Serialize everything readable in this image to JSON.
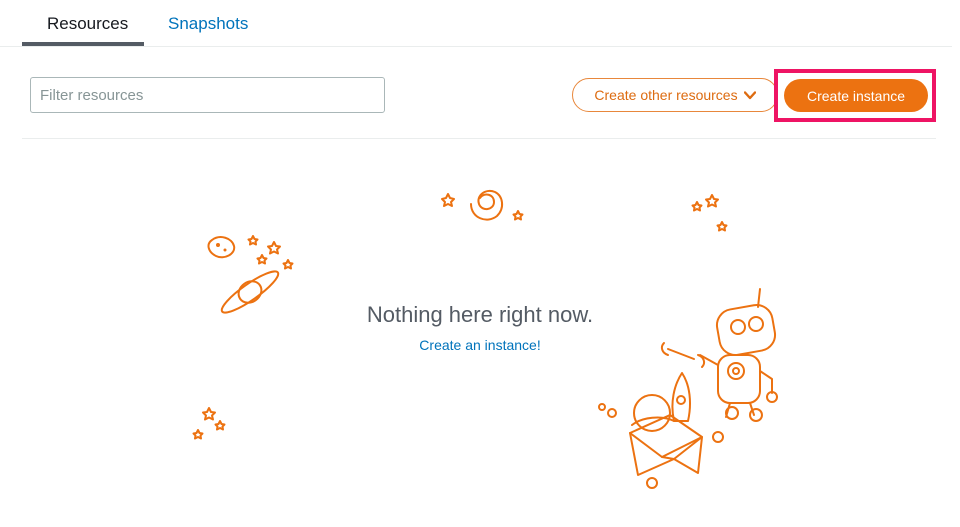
{
  "tabs": [
    {
      "label": "Resources",
      "active": true
    },
    {
      "label": "Snapshots",
      "active": false
    }
  ],
  "toolbar": {
    "filter_placeholder": "Filter resources",
    "filter_value": "",
    "create_other_label": "Create other resources",
    "create_instance_label": "Create instance"
  },
  "empty_state": {
    "message": "Nothing here right now.",
    "link_label": "Create an instance!"
  },
  "colors": {
    "accent": "#ec7211",
    "link": "#0073bb",
    "highlight": "#ee1464"
  }
}
